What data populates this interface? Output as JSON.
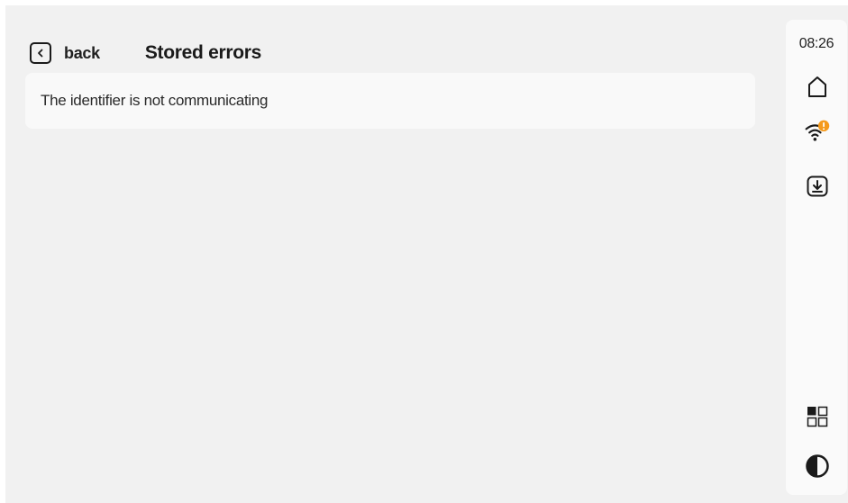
{
  "header": {
    "back_label": "back",
    "title": "Stored errors"
  },
  "errors": [
    {
      "message": "The identifier is not communicating"
    }
  ],
  "sidebar": {
    "time": "08:26",
    "icons": [
      "home-icon",
      "wifi-warning-icon",
      "download-icon",
      "apps-grid-icon",
      "contrast-icon"
    ],
    "warning_color": "#f59a1b"
  }
}
